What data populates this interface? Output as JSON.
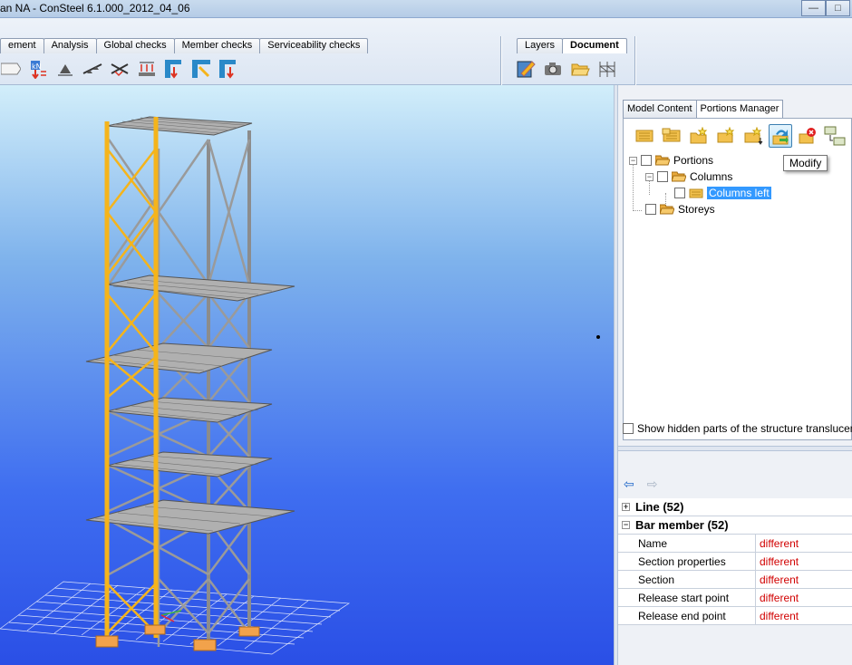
{
  "window": {
    "title": "an NA - ConSteel 6.1.000_2012_04_06",
    "buttons": [
      "minimize",
      "maximize",
      "close"
    ]
  },
  "toolbar": {
    "tabs": [
      "ement",
      "Analysis",
      "Global checks",
      "Member checks",
      "Serviceability checks"
    ],
    "right_tabs": [
      {
        "label": "Layers",
        "active": false
      },
      {
        "label": "Document",
        "active": true
      }
    ],
    "left_icons": [
      "member-icon",
      "load-icon",
      "support-icon",
      "line-support-icon",
      "bracing-icon",
      "load-group-icon",
      "column-section-icon",
      "frame-icon",
      "member-down-icon"
    ],
    "right_icons": [
      "edit-document-icon",
      "camera-icon",
      "open-folder-icon",
      "structure-icon"
    ]
  },
  "panel": {
    "tabs": [
      {
        "label": "Model Content",
        "active": false
      },
      {
        "label": "Portions Manager",
        "active": true
      }
    ],
    "icons": [
      "portion-new-icon",
      "portion-copy-icon",
      "folder-new-icon",
      "portion-star-icon",
      "portion-star-down-icon",
      "modify-icon",
      "delete-icon",
      "rename-icon"
    ],
    "tooltip": "Modify",
    "tree": [
      {
        "label": "Portions",
        "level": 0,
        "expanded": true,
        "selected": false
      },
      {
        "label": "Columns",
        "level": 1,
        "expanded": true,
        "selected": false
      },
      {
        "label": "Columns left",
        "level": 2,
        "expanded": false,
        "selected": true
      },
      {
        "label": "Storeys",
        "level": 0,
        "expanded": false,
        "selected": false
      }
    ],
    "show_hidden_label": "Show hidden parts of the structure translucently",
    "show_hidden_checked": false
  },
  "properties": {
    "categories": [
      {
        "label": "Line (52)",
        "expanded": false
      },
      {
        "label": "Bar member (52)",
        "expanded": true
      }
    ],
    "rows": [
      {
        "key": "Name",
        "value": "different"
      },
      {
        "key": "Section properties",
        "value": "different"
      },
      {
        "key": "Section",
        "value": "different"
      },
      {
        "key": "Release start point",
        "value": "different"
      },
      {
        "key": "Release end point",
        "value": "different"
      }
    ]
  },
  "colors": {
    "selected_member": "#f5b41b",
    "steel_member": "#8c8c8c",
    "viewport_sky_top": "#d2eefa",
    "viewport_bottom": "#2a4fe6",
    "error_red": "#d10000",
    "selection_blue": "#3399ff"
  }
}
